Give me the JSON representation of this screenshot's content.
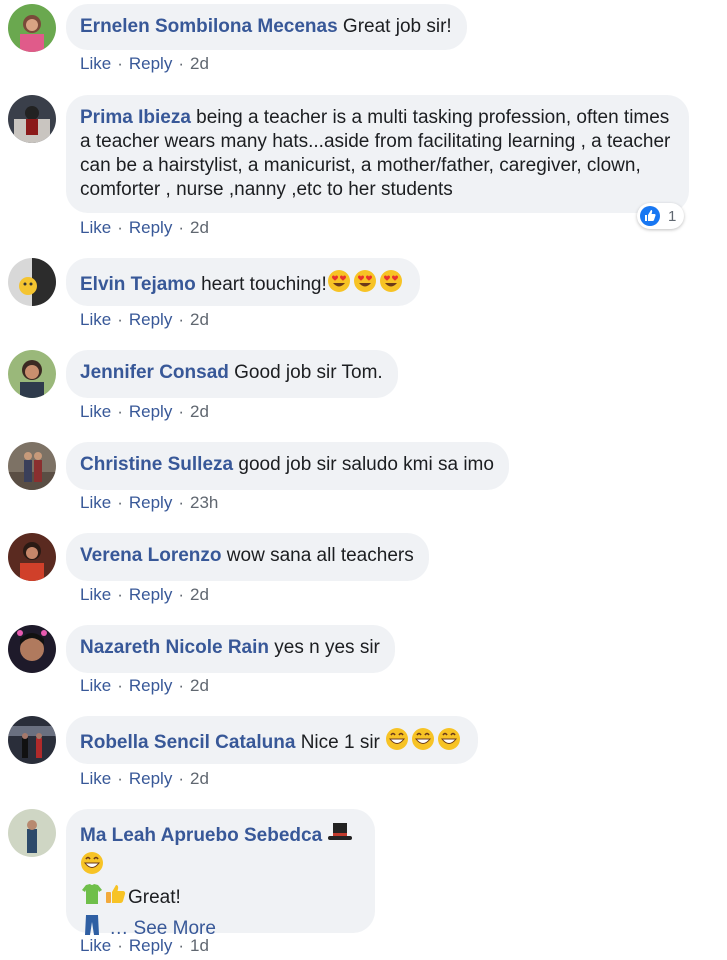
{
  "actions": {
    "like": "Like",
    "reply": "Reply",
    "separator": "·"
  },
  "comments": [
    {
      "author": "Ernelen Sombilona Mecenas",
      "text": "Great job sir!",
      "time": "2d"
    },
    {
      "author": "Prima Ibieza",
      "text": "being a teacher is a multi tasking profession, often times a teacher wears many hats...aside from facilitating learning , a teacher can be a hairstylist, a manicurist, a mother/father, caregiver, clown, comforter , nurse ,nanny ,etc to her students",
      "time": "2d",
      "reaction_count": "1"
    },
    {
      "author": "Elvin Tejamo",
      "text": "heart touching!",
      "time": "2d"
    },
    {
      "author": "Jennifer Consad",
      "text": "Good job sir Tom.",
      "time": "2d"
    },
    {
      "author": "Christine Sulleza",
      "text": "good job sir saludo kmi sa imo",
      "time": "23h"
    },
    {
      "author": "Verena Lorenzo",
      "text": "wow sana all teachers",
      "time": "2d"
    },
    {
      "author": "Nazareth Nicole Rain",
      "text": "yes n yes sir",
      "time": "2d"
    },
    {
      "author": "Robella Sencil Cataluna",
      "text": "Nice 1 sir",
      "time": "2d"
    },
    {
      "author": "Ma Leah Apruebo Sebedca",
      "text": "Great!",
      "more": "… See More",
      "time": "1d"
    }
  ],
  "colors": {
    "author": "#385898",
    "bubble": "#f0f2f5",
    "meta": "#606770",
    "like_blue": "#1877f2"
  }
}
